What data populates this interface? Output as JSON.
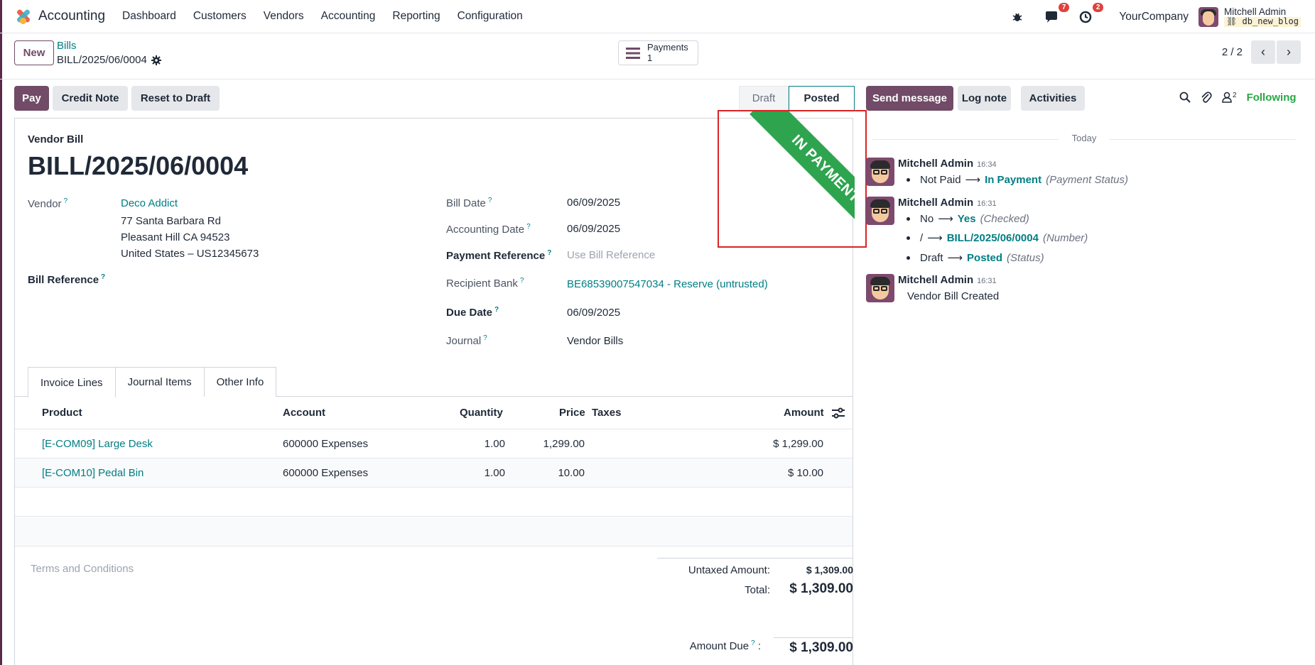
{
  "navbar": {
    "app_name": "Accounting",
    "menu": [
      "Dashboard",
      "Customers",
      "Vendors",
      "Accounting",
      "Reporting",
      "Configuration"
    ],
    "messages_count": "7",
    "activities_count": "2",
    "company": "YourCompany",
    "user_name": "Mitchell Admin",
    "db_name": "db_new_blog"
  },
  "control": {
    "new_label": "New",
    "breadcrumb_parent": "Bills",
    "breadcrumb_current": "BILL/2025/06/0004",
    "payments_label": "Payments",
    "payments_count": "1",
    "pager_value": "2 / 2"
  },
  "actions": {
    "pay": "Pay",
    "credit_note": "Credit Note",
    "reset_to_draft": "Reset to Draft",
    "status_draft": "Draft",
    "status_posted": "Posted"
  },
  "form": {
    "doc_type": "Vendor Bill",
    "title": "BILL/2025/06/0004",
    "ribbon": "IN PAYMENT",
    "vendor_label": "Vendor",
    "vendor_name": "Deco Addict",
    "vendor_addr1": "77 Santa Barbara Rd",
    "vendor_addr2": "Pleasant Hill CA 94523",
    "vendor_addr3": "United States – US12345673",
    "bill_reference_label": "Bill Reference",
    "bill_date_label": "Bill Date",
    "bill_date": "06/09/2025",
    "accounting_date_label": "Accounting Date",
    "accounting_date": "06/09/2025",
    "payment_ref_label": "Payment Reference",
    "payment_ref_placeholder": "Use Bill Reference",
    "recipient_bank_label": "Recipient Bank",
    "recipient_bank": "BE68539007547034 - Reserve (untrusted)",
    "due_date_label": "Due Date",
    "due_date": "06/09/2025",
    "journal_label": "Journal",
    "journal": "Vendor Bills",
    "help_mark": "?"
  },
  "tabs": [
    "Invoice Lines",
    "Journal Items",
    "Other Info"
  ],
  "lines": {
    "headers": {
      "product": "Product",
      "account": "Account",
      "quantity": "Quantity",
      "price": "Price",
      "taxes": "Taxes",
      "amount": "Amount"
    },
    "rows": [
      {
        "product": "[E-COM09] Large Desk",
        "account": "600000 Expenses",
        "quantity": "1.00",
        "price": "1,299.00",
        "amount": "$ 1,299.00"
      },
      {
        "product": "[E-COM10] Pedal Bin",
        "account": "600000 Expenses",
        "quantity": "1.00",
        "price": "10.00",
        "amount": "$ 10.00"
      }
    ]
  },
  "totals": {
    "terms_placeholder": "Terms and Conditions",
    "untaxed_label": "Untaxed Amount:",
    "untaxed_value": "$ 1,309.00",
    "total_label": "Total:",
    "total_value": "$ 1,309.00",
    "amount_due_label": "Amount Due",
    "amount_due_colon": ":",
    "amount_due_value": "$ 1,309.00"
  },
  "chatter": {
    "send_message": "Send message",
    "log_note": "Log note",
    "activities": "Activities",
    "followers_count": "2",
    "following": "Following",
    "today": "Today",
    "messages": [
      {
        "author": "Mitchell Admin",
        "time": "16:34",
        "tracking": [
          {
            "old": "Not Paid",
            "new": "In Payment",
            "field": "(Payment Status)"
          }
        ]
      },
      {
        "author": "Mitchell Admin",
        "time": "16:31",
        "tracking": [
          {
            "old": "No",
            "new": "Yes",
            "field": "(Checked)"
          },
          {
            "old": "/",
            "new": "BILL/2025/06/0004",
            "field": "(Number)"
          },
          {
            "old": "Draft",
            "new": "Posted",
            "field": "(Status)"
          }
        ]
      },
      {
        "author": "Mitchell Admin",
        "time": "16:31",
        "body": "Vendor Bill Created"
      }
    ]
  }
}
